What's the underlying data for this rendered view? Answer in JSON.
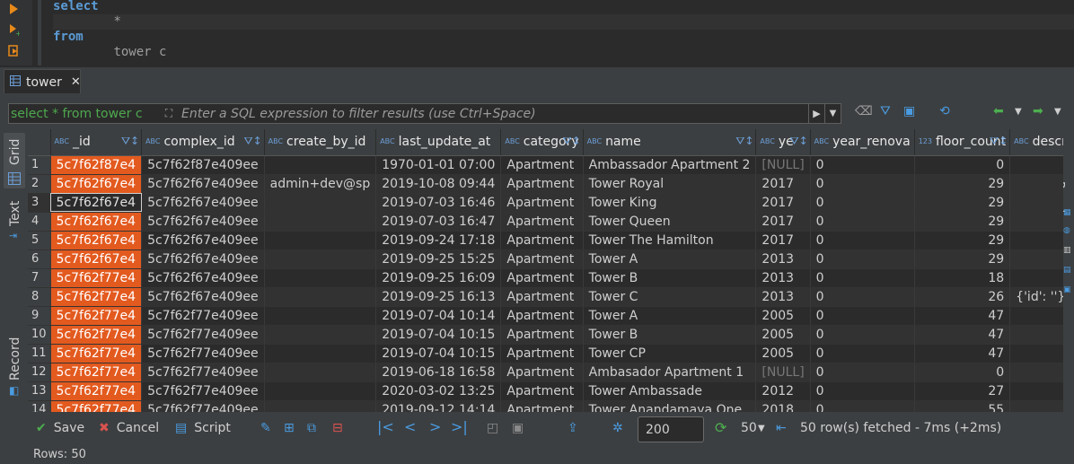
{
  "editor": {
    "lines": [
      "select",
      "\t*",
      "from",
      "\ttower c"
    ]
  },
  "tab": {
    "label": "tower"
  },
  "filter": {
    "history": "select * from tower c",
    "placeholder": "Enter a SQL expression to filter results (use Ctrl+Space)"
  },
  "side": {
    "grid_label": "Grid",
    "text_label": "Text",
    "record_label": "Record",
    "panels_label": "Panels"
  },
  "columns": [
    "_id",
    "complex_id",
    "create_by_id",
    "last_update_at",
    "category",
    "name",
    "ye",
    "year_renova",
    "floor_count",
    "description"
  ],
  "rows": [
    [
      "1",
      "5c7f62f87e4",
      "5c7f62f87e409ee",
      "",
      "1970-01-01 07:00",
      "Apartment",
      "Ambassador Apartment 2",
      "[NULL]",
      "0",
      "0",
      ""
    ],
    [
      "2",
      "5c7f62f67e4",
      "5c7f62f67e409ee",
      "admin+dev@sp",
      "2019-10-08 09:44",
      "Apartment",
      "Tower Royal",
      "2017",
      "0",
      "29",
      ""
    ],
    [
      "3",
      "5c7f62f67e4",
      "5c7f62f67e409ee",
      "",
      "2019-07-03 16:46",
      "Apartment",
      "Tower King",
      "2017",
      "0",
      "29",
      ""
    ],
    [
      "4",
      "5c7f62f67e4",
      "5c7f62f67e409ee",
      "",
      "2019-07-03 16:47",
      "Apartment",
      "Tower Queen",
      "2017",
      "0",
      "29",
      ""
    ],
    [
      "5",
      "5c7f62f67e4",
      "5c7f62f67e409ee",
      "",
      "2019-09-24 17:18",
      "Apartment",
      "Tower The Hamilton",
      "2017",
      "0",
      "29",
      ""
    ],
    [
      "6",
      "5c7f62f67e4",
      "5c7f62f67e409ee",
      "",
      "2019-09-25 15:25",
      "Apartment",
      "Tower A",
      "2013",
      "0",
      "29",
      ""
    ],
    [
      "7",
      "5c7f62f77e4",
      "5c7f62f67e409ee",
      "",
      "2019-09-25 16:09",
      "Apartment",
      "Tower B",
      "2013",
      "0",
      "18",
      ""
    ],
    [
      "8",
      "5c7f62f77e4",
      "5c7f62f67e409ee",
      "",
      "2019-09-25 16:13",
      "Apartment",
      "Tower C",
      "2013",
      "0",
      "26",
      "{'id': ''}"
    ],
    [
      "9",
      "5c7f62f77e4",
      "5c7f62f77e409ee",
      "",
      "2019-07-04 10:14",
      "Apartment",
      "Tower A",
      "2005",
      "0",
      "47",
      ""
    ],
    [
      "10",
      "5c7f62f77e4",
      "5c7f62f77e409ee",
      "",
      "2019-07-04 10:15",
      "Apartment",
      "Tower B",
      "2005",
      "0",
      "47",
      ""
    ],
    [
      "11",
      "5c7f62f77e4",
      "5c7f62f77e409ee",
      "",
      "2019-07-04 10:15",
      "Apartment",
      "Tower CP",
      "2005",
      "0",
      "47",
      ""
    ],
    [
      "12",
      "5c7f62f77e4",
      "5c7f62f77e409ee",
      "",
      "2019-06-18 16:58",
      "Apartment",
      "Ambasador Apartment 1",
      "[NULL]",
      "0",
      "0",
      ""
    ],
    [
      "13",
      "5c7f62f77e4",
      "5c7f62f77e409ee",
      "",
      "2020-03-02 13:25",
      "Apartment",
      "Tower Ambassade",
      "2012",
      "0",
      "27",
      ""
    ],
    [
      "14",
      "5c7f62f77e4",
      "5c7f62f77e409ee",
      "",
      "2019-09-12 14:14",
      "Apartment",
      "Tower Anandamaya One",
      "2018",
      "0",
      "55",
      ""
    ]
  ],
  "toolbar": {
    "save": "Save",
    "cancel": "Cancel",
    "script": "Script",
    "fetch_size": "200",
    "fetch_count": "50",
    "fetched": "50 row(s) fetched - 7ms (+2ms)"
  },
  "status": {
    "rows": "Rows: 50"
  },
  "colors": {
    "id_cell": "#e35a1f",
    "keyword": "#5b9bd5",
    "accent": "#4a9be0"
  }
}
